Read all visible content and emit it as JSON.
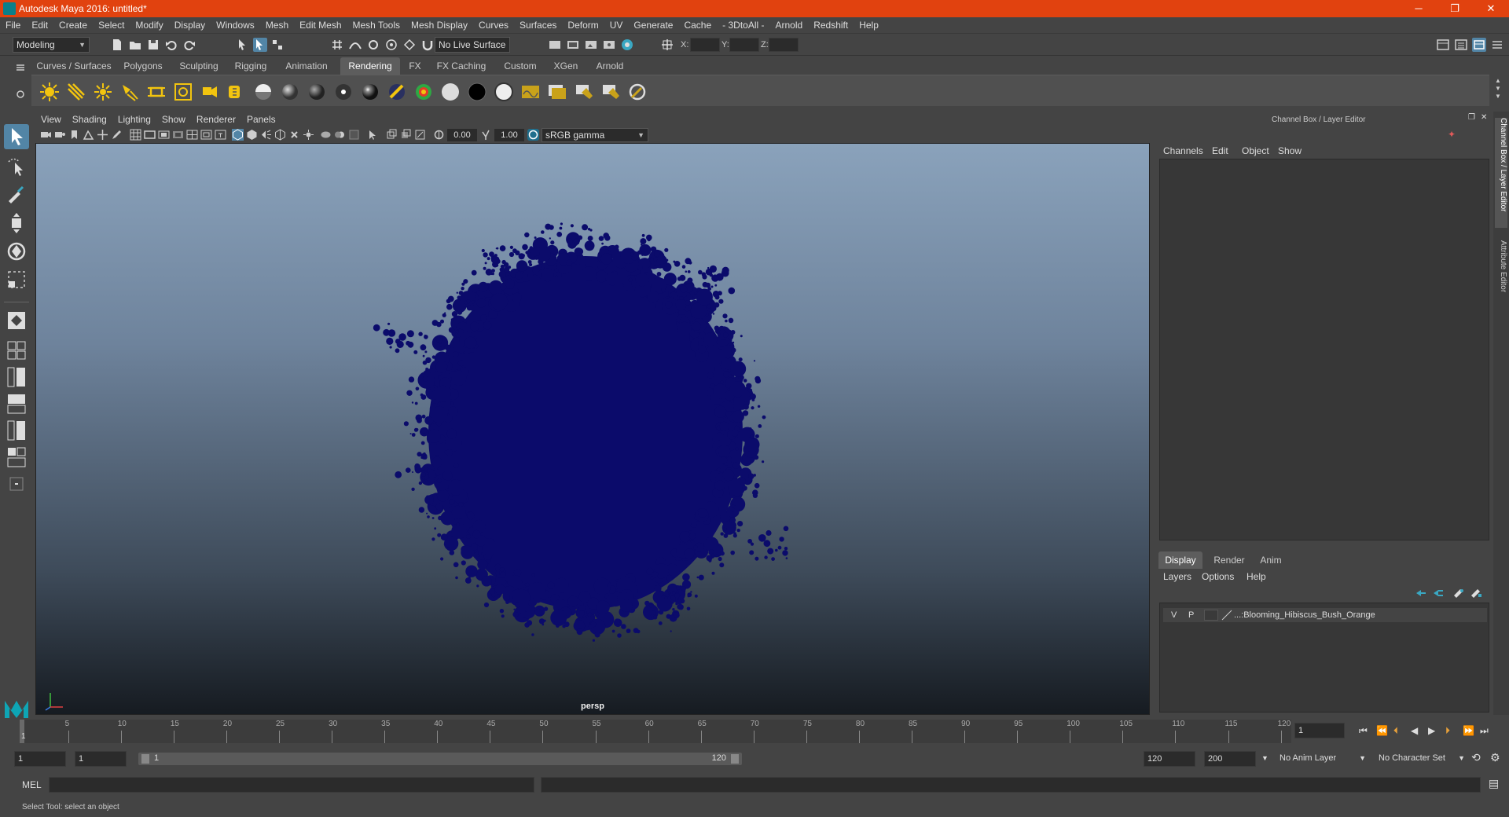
{
  "titlebar": {
    "title": "Autodesk Maya 2016: untitled*",
    "minimize": "─",
    "restore": "❐",
    "close": "✕"
  },
  "menubar": [
    "File",
    "Edit",
    "Create",
    "Select",
    "Modify",
    "Display",
    "Windows",
    "Mesh",
    "Edit Mesh",
    "Mesh Tools",
    "Mesh Display",
    "Curves",
    "Surfaces",
    "Deform",
    "UV",
    "Generate",
    "Cache",
    "- 3DtoAll -",
    "Arnold",
    "Redshift",
    "Help"
  ],
  "statusline": {
    "workspace": "Modeling",
    "live_surface": "No Live Surface",
    "x_label": "X:",
    "y_label": "Y:",
    "z_label": "Z:"
  },
  "shelf": {
    "tabs": [
      "Curves / Surfaces",
      "Polygons",
      "Sculpting",
      "Rigging",
      "Animation",
      "Rendering",
      "FX",
      "FX Caching",
      "Custom",
      "XGen",
      "Arnold"
    ],
    "active_tab": "Rendering"
  },
  "viewport": {
    "menus": [
      "View",
      "Shading",
      "Lighting",
      "Show",
      "Renderer",
      "Panels"
    ],
    "exposure": "0.00",
    "gamma": "1.00",
    "color_space": "sRGB gamma",
    "camera": "persp",
    "object_color": "#0b0b6b"
  },
  "right_panel": {
    "header": "Channel Box / Layer Editor",
    "channel_menus": [
      "Channels",
      "Edit",
      "Object",
      "Show"
    ],
    "layer_tabs": [
      "Display",
      "Render",
      "Anim"
    ],
    "active_layer_tab": "Display",
    "layer_menus": [
      "Layers",
      "Options",
      "Help"
    ],
    "layer": {
      "v": "V",
      "p": "P",
      "name": "...:Blooming_Hibiscus_Bush_Orange"
    },
    "side_tabs": [
      "Channel Box / Layer Editor",
      "Attribute Editor"
    ]
  },
  "timeline": {
    "labels": [
      "5",
      "10",
      "15",
      "20",
      "25",
      "30",
      "35",
      "40",
      "45",
      "50",
      "55",
      "60",
      "65",
      "70",
      "75",
      "80",
      "85",
      "90",
      "95",
      "100",
      "105",
      "110",
      "115",
      "120"
    ],
    "current_frame_marker": "1",
    "current_frame_field": "1"
  },
  "range": {
    "start": "1",
    "playback_start": "1",
    "slider_start": "1",
    "slider_end": "120",
    "playback_end": "120",
    "end": "200",
    "anim_layer": "No Anim Layer",
    "character_set": "No Character Set"
  },
  "cmdline": {
    "label": "MEL"
  },
  "helpline": {
    "text": "Select Tool: select an object"
  }
}
